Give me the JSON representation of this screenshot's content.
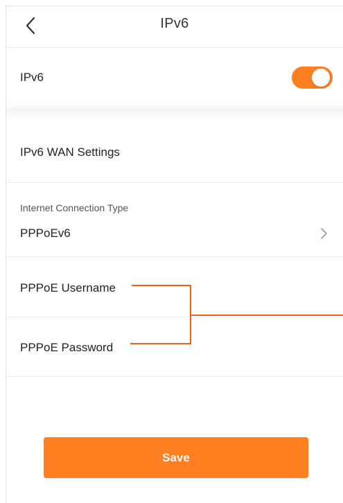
{
  "header": {
    "title": "IPv6",
    "back_icon": "chevron-left-icon"
  },
  "ipv6_toggle": {
    "label": "IPv6",
    "enabled": true,
    "accent_color": "#ff7f21"
  },
  "wan_settings": {
    "title": "IPv6 WAN Settings"
  },
  "connection_type": {
    "label": "Internet Connection Type",
    "value": "PPPoEv6",
    "icon": "chevron-right-icon"
  },
  "pppoe": {
    "username_label": "PPPoE Username",
    "password_label": "PPPoE Password"
  },
  "actions": {
    "save_label": "Save"
  },
  "colors": {
    "accent": "#ff7f21",
    "divider": "#ececec",
    "text": "#222222"
  }
}
